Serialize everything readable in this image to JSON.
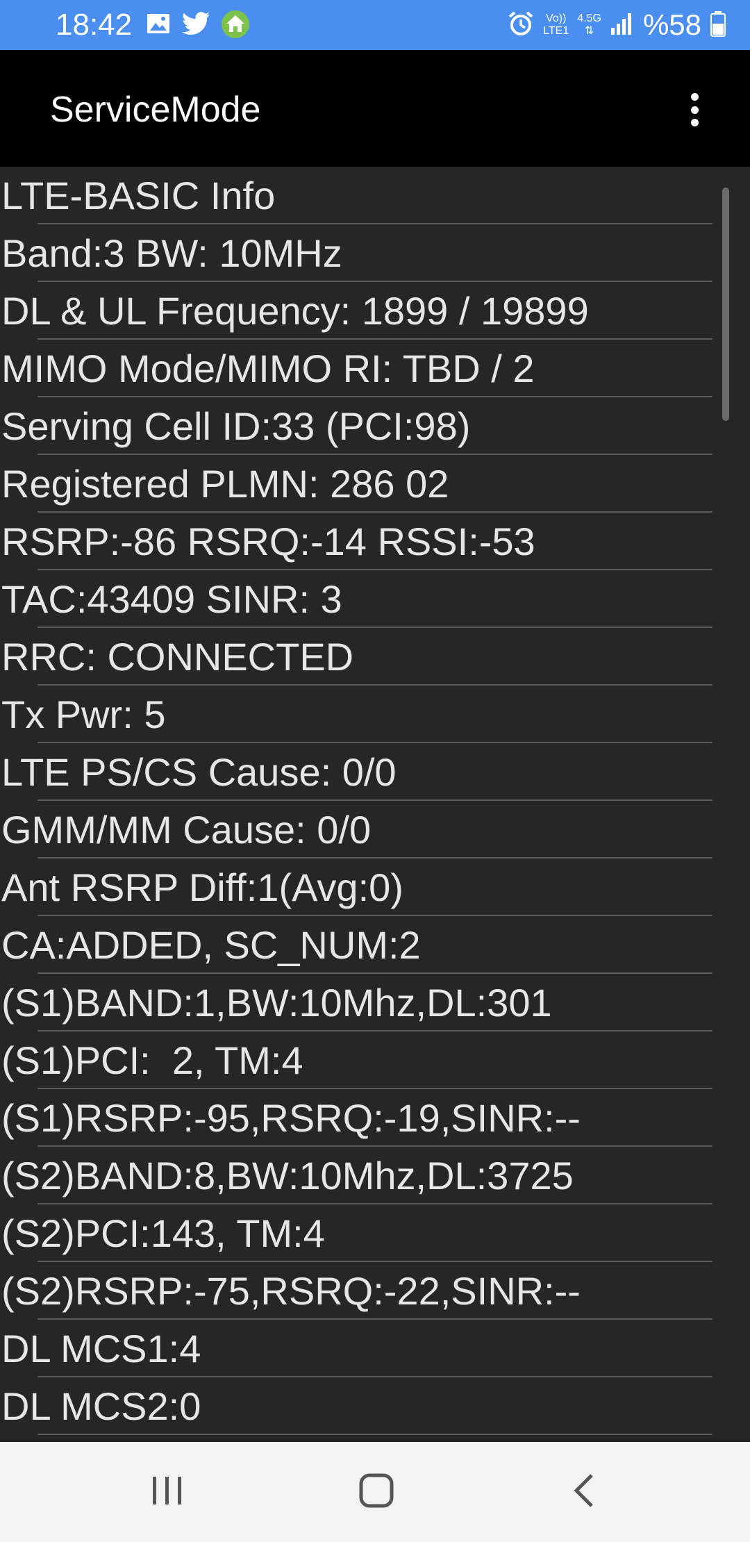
{
  "status_bar": {
    "time": "18:42",
    "left_icons": [
      "gallery-icon",
      "twitter-icon",
      "home-app-icon"
    ],
    "right_icons": [
      "alarm-icon",
      "volte-icon",
      "network-4-5g-icon",
      "signal-icon",
      "battery-icon"
    ],
    "volte_line1": "Vo))",
    "volte_line2": "LTE1",
    "network_label": "4.5G",
    "battery": "%58",
    "background_color": "#4a8ff0"
  },
  "app_bar": {
    "title": "ServiceMode",
    "menu_icon": "more-vert-icon"
  },
  "info_lines": [
    "LTE-BASIC Info",
    "Band:3 BW: 10MHz",
    "DL & UL Frequency: 1899 / 19899",
    "MIMO Mode/MIMO RI: TBD / 2",
    "Serving Cell ID:33 (PCI:98)",
    "Registered PLMN: 286 02",
    "RSRP:-86 RSRQ:-14 RSSI:-53",
    "TAC:43409 SINR: 3",
    "RRC: CONNECTED",
    "Tx Pwr: 5",
    "LTE PS/CS Cause: 0/0",
    "GMM/MM Cause: 0/0",
    "Ant RSRP Diff:1(Avg:0)",
    "CA:ADDED, SC_NUM:2",
    "(S1)BAND:1,BW:10Mhz,DL:301",
    "(S1)PCI:  2, TM:4",
    "(S1)RSRP:-95,RSRQ:-19,SINR:--",
    "(S2)BAND:8,BW:10Mhz,DL:3725",
    "(S2)PCI:143, TM:4",
    "(S2)RSRP:-75,RSRQ:-22,SINR:--",
    "DL MCS1:4",
    "DL MCS2:0"
  ],
  "nav_bar": {
    "buttons": [
      "recent-apps-icon",
      "home-icon",
      "back-icon"
    ]
  }
}
